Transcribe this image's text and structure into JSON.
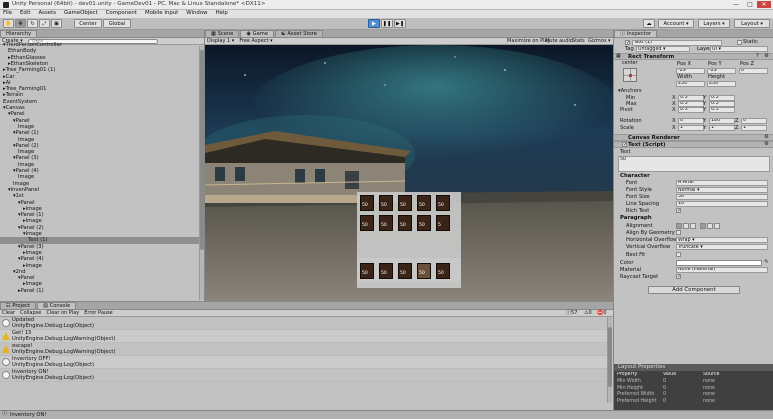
{
  "window": {
    "title": "Unity Personal (64bit) - dev01.unity - GameDev01 - PC, Mac & Linux Standalone* <DX11>",
    "controls": [
      "—",
      "□",
      "✕"
    ]
  },
  "menu": [
    "File",
    "Edit",
    "Assets",
    "GameObject",
    "Component",
    "Mobile Input",
    "Window",
    "Help"
  ],
  "toolbar": {
    "tools": [
      "hand-tool",
      "move-tool",
      "rotate-tool",
      "scale-tool",
      "rect-tool"
    ],
    "pivot": "Center",
    "space": "Global",
    "account": "Account",
    "layers": "Layers",
    "layout": "Layout"
  },
  "hierarchy": {
    "tab": "Hierarchy",
    "create": "Create",
    "search_placeholder": "Q▾All",
    "rows": [
      {
        "indent": 0,
        "label": "▾ThirdPersonController"
      },
      {
        "indent": 1,
        "label": "EthanBody"
      },
      {
        "indent": 1,
        "label": "▸EthanGlasses"
      },
      {
        "indent": 1,
        "label": "▸EthanSkeleton"
      },
      {
        "indent": 0,
        "label": "▸Tree_Farming01 (1)"
      },
      {
        "indent": 0,
        "label": "▸Car"
      },
      {
        "indent": 0,
        "label": "▸Ai"
      },
      {
        "indent": 0,
        "label": "▸Tree_Farming01"
      },
      {
        "indent": 0,
        "label": "▸Terrain"
      },
      {
        "indent": 0,
        "label": "EventSystem"
      },
      {
        "indent": 0,
        "label": "▾Canvas"
      },
      {
        "indent": 1,
        "label": "▾Panel"
      },
      {
        "indent": 2,
        "label": "▾Panel"
      },
      {
        "indent": 3,
        "label": "Image"
      },
      {
        "indent": 2,
        "label": "▾Panel (1)"
      },
      {
        "indent": 3,
        "label": "Image"
      },
      {
        "indent": 2,
        "label": "▾Panel (2)"
      },
      {
        "indent": 3,
        "label": "Image"
      },
      {
        "indent": 2,
        "label": "▾Panel (3)"
      },
      {
        "indent": 3,
        "label": "Image"
      },
      {
        "indent": 2,
        "label": "▾Panel (4)"
      },
      {
        "indent": 3,
        "label": "Image"
      },
      {
        "indent": 2,
        "label": "Image"
      },
      {
        "indent": 1,
        "label": "▾InvenPanel"
      },
      {
        "indent": 2,
        "label": "▾1st"
      },
      {
        "indent": 3,
        "label": "▾Panel"
      },
      {
        "indent": 4,
        "label": "▸Image"
      },
      {
        "indent": 3,
        "label": "▾Panel (1)"
      },
      {
        "indent": 4,
        "label": "▸Image"
      },
      {
        "indent": 3,
        "label": "▾Panel (2)"
      },
      {
        "indent": 4,
        "label": "▾Image"
      },
      {
        "indent": 5,
        "label": "Text (1)",
        "selected": true
      },
      {
        "indent": 3,
        "label": "▾Panel (3)"
      },
      {
        "indent": 4,
        "label": "▸Image"
      },
      {
        "indent": 3,
        "label": "▾Panel (4)"
      },
      {
        "indent": 4,
        "label": "▸Image"
      },
      {
        "indent": 2,
        "label": "▾2nd"
      },
      {
        "indent": 3,
        "label": "▾Panel"
      },
      {
        "indent": 4,
        "label": "▸Image"
      },
      {
        "indent": 3,
        "label": "▸Panel (1)"
      }
    ]
  },
  "center_tabs": [
    "Scene",
    "Game",
    "Asset Store"
  ],
  "game_bar": {
    "display": "Display 1",
    "aspect": "Free Aspect",
    "maximize": "Maximize on Play",
    "mute": "Mute audio",
    "stats": "Stats",
    "gizmos": "Gizmos"
  },
  "inventory": {
    "slot_label": "50",
    "rows": [
      [
        "50",
        "50",
        "50",
        "50",
        "50"
      ],
      [
        "50",
        "50",
        "50",
        "50",
        "5"
      ]
    ],
    "hotbar": [
      "50",
      "50",
      "50",
      "50",
      "50"
    ]
  },
  "bottom_tabs": [
    "Project",
    "Console"
  ],
  "console": {
    "buttons": [
      "Clear",
      "Collapse",
      "Clear on Play",
      "Error Pause"
    ],
    "counts": [
      "57",
      "0",
      "0"
    ],
    "rows": [
      {
        "type": "info",
        "line1": "Updated",
        "line2": "UnityEngine.Debug:Log(Object)"
      },
      {
        "type": "warn",
        "line1": "Get! 15",
        "line2": "UnityEngine.Debug:LogWarning(Object)"
      },
      {
        "type": "warn",
        "line1": "escape!",
        "line2": "UnityEngine.Debug:LogWarning(Object)"
      },
      {
        "type": "info",
        "line1": "Inventory OFF!",
        "line2": "UnityEngine.Debug:Log(Object)"
      },
      {
        "type": "info",
        "line1": "Inventory ON!",
        "line2": "UnityEngine.Debug:Log(Object)"
      }
    ]
  },
  "status_bar": "Inventory ON!",
  "inspector": {
    "tab": "Inspector",
    "object_name": "Text (1)",
    "static": "Static",
    "tag_label": "Tag",
    "tag": "Untagged",
    "layer_label": "Layer",
    "layer": "UI",
    "rect_transform": {
      "title": "Rect Transform",
      "anchor": "center",
      "posx_label": "Pos X",
      "posy_label": "Pos Y",
      "posz_label": "Pos Z",
      "posx": "-29",
      "posy": "-29",
      "posz": "0",
      "width_label": "Width",
      "height_label": "Height",
      "width": "250",
      "height": "250",
      "anchors": "Anchors",
      "min": "Min",
      "max": "Max",
      "pivot": "Pivot",
      "min_x": "0.5",
      "min_y": "0.5",
      "max_x": "0.5",
      "max_y": "0.5",
      "pivot_x": "0.5",
      "pivot_y": "0.5",
      "rotation": "Rotation",
      "scale": "Scale",
      "rot_x": "0",
      "rot_y": "180",
      "rot_z": "0",
      "scale_x": "1",
      "scale_y": "1",
      "scale_z": "1"
    },
    "canvas_renderer": "Canvas Renderer",
    "text_script": "Text (Script)",
    "text_label": "Text",
    "text_value": "50",
    "character": "Character",
    "font": "Font",
    "font_val": "Arial",
    "font_style": "Font Style",
    "font_style_val": "Normal",
    "font_size": "Font Size",
    "font_size_val": "30",
    "line_spacing": "Line Spacing",
    "line_spacing_val": "10",
    "rich_text": "Rich Text",
    "paragraph": "Paragraph",
    "alignment": "Alignment",
    "align_geometry": "Align By Geometry",
    "h_overflow": "Horizontal Overflow",
    "h_overflow_val": "Wrap",
    "v_overflow": "Vertical Overflow",
    "v_overflow_val": "Truncate",
    "best_fit": "Best Fit",
    "color": "Color",
    "material": "Material",
    "material_val": "None (Material)",
    "raycast": "Raycast Target",
    "add_component": "Add Component"
  },
  "layout_properties": {
    "title": "Layout Properties",
    "headers": [
      "Property",
      "Value",
      "Source"
    ],
    "rows": [
      [
        "Min Width",
        "0",
        "none"
      ],
      [
        "Min Height",
        "0",
        "none"
      ],
      [
        "Preferred Width",
        "0",
        "none"
      ],
      [
        "Preferred Height",
        "0",
        "none"
      ]
    ]
  }
}
